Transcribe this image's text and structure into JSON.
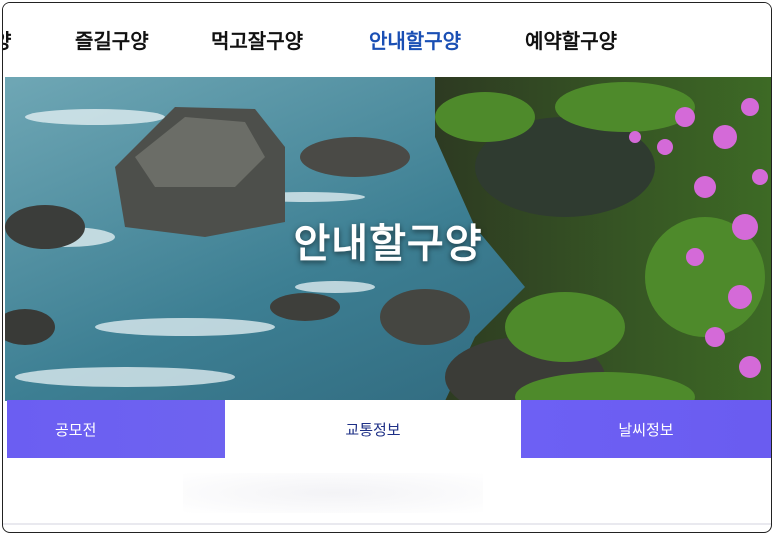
{
  "nav": {
    "items": [
      {
        "label": "양"
      },
      {
        "label": "즐길구양"
      },
      {
        "label": "먹고잘구양"
      },
      {
        "label": "안내할구양"
      },
      {
        "label": "예약할구양"
      }
    ],
    "active_color": "#1a4fb4"
  },
  "hero": {
    "title": "안내할구양",
    "image": "river-rocks-flowers-photo"
  },
  "subtabs": [
    {
      "label": "공모전"
    },
    {
      "label": "교통정보"
    },
    {
      "label": "날씨정보"
    }
  ],
  "colors": {
    "accent": "#6b5ef2",
    "selected_tab_text": "#1d2f86"
  }
}
